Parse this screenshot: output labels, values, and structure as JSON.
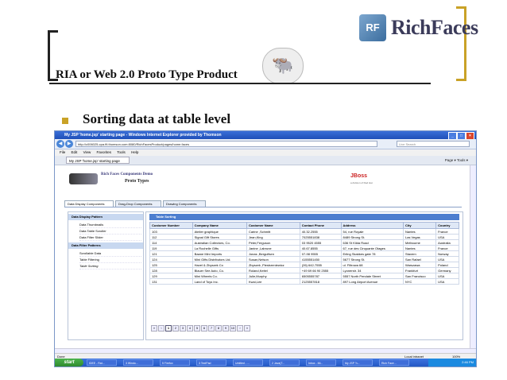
{
  "slide": {
    "logo_text": "RichFaces",
    "title": "RIA or Web 2.0 Proto Type Product",
    "bullet": "Sorting data at table level"
  },
  "browser": {
    "window_title": "My JSP 'home.jsp' starting page - Windows Internet Explorer provided by Thomson",
    "url": "http://c006025-cpa.ftl.thomson.com:8080/RichFacesProduct/pages/home.faces",
    "search_placeholder": "Live Search",
    "menu": [
      "File",
      "Edit",
      "View",
      "Favorites",
      "Tools",
      "Help"
    ],
    "tab_label": "My JSP 'home.jsp' starting page",
    "tab_tools": "Page ▾  Tools ▾",
    "status_left": "Done",
    "status_zone": "Local intranet",
    "status_zoom": "100%"
  },
  "page": {
    "demo_title": "Rich Faces Components Demo",
    "demo_subtitle": "Proto Types",
    "jboss_logo": "JBoss",
    "jboss_sub": "a division of Red Hat",
    "tabs": [
      "Data Display Components",
      "Drag-Drop Components",
      "Drawing Components"
    ],
    "left_panel": {
      "group1_title": "Data Display Pattern",
      "group1_items": [
        "Data Thumbnails",
        "Data Table Scroller",
        "Data Filter Slider"
      ],
      "group2_title": "Data Filter Patterns",
      "group2_items": [
        "Scrollable Data",
        "Table Filtering",
        "Table Sorting"
      ]
    },
    "table": {
      "header": "Table Sorting",
      "columns": [
        "Customer Number",
        "Company Name",
        "Customer Name",
        "Contact Phone",
        "Address",
        "City",
        "Country"
      ],
      "rows": [
        [
          "103",
          "Atelier graphique",
          "Carine ,Schmitt",
          "40.32.2555",
          "54, rue Royale",
          "Nantes",
          "France"
        ],
        [
          "112",
          "Signal Gift Stores",
          "Jean,King",
          "7025551838",
          "8489 Strong St.",
          "Las Vegas",
          "USA"
        ],
        [
          "114",
          "Australian Collectors, Co.",
          "Peter,Ferguson",
          "03 9520 4555",
          "636 St Kilda Road",
          "Melbourne",
          "Australia"
        ],
        [
          "119",
          "La Rochelle Gifts",
          "Janine ,Labrune",
          "40.67.8555",
          "67, rue des Cinquante Otages",
          "Nantes",
          "France"
        ],
        [
          "121",
          "Baane Mini Imports",
          "Jonas ,Bergulfsen",
          "07-98 9555",
          "Erling Skakkes gate 78",
          "Stavern",
          "Norway"
        ],
        [
          "124",
          "Mini Gifts Distributors Ltd.",
          "Susan,Nelson",
          "4155551450",
          "5677 Strong St.",
          "San Rafael",
          "USA"
        ],
        [
          "125",
          "Havel & Zbyszek Co",
          "Zbyszek ,Piestrzeniewicz",
          "(26) 642-7555",
          "ul. Filtrowa 68",
          "Warszawa",
          "Poland"
        ],
        [
          "128",
          "Blauer See Auto, Co.",
          "Roland,Keitel",
          "+49 69 66 90 2555",
          "Lyonerstr. 34",
          "Frankfurt",
          "Germany"
        ],
        [
          "129",
          "Mini Wheels Co.",
          "Julie,Murphy",
          "6505555787",
          "5557 North Pendale Street",
          "San Francisco",
          "USA"
        ],
        [
          "131",
          "Land of Toys Inc.",
          "Kwai,Lee",
          "2125557818",
          "897 Long Airport Avenue",
          "NYC",
          "USA"
        ]
      ],
      "pager": [
        "«",
        "‹",
        "1",
        "2",
        "3",
        "4",
        "5",
        "6",
        "7",
        "8",
        "9",
        "10",
        "›",
        "»"
      ]
    }
  },
  "taskbar": {
    "start": "start",
    "tasks": [
      "IDEE - Rat...",
      "3 Windo...",
      "5 Firefox",
      "3 TextPad",
      "Untitled - ...",
      "2 Java(T...",
      "Inbox - Mi...",
      "My JSP 'h...",
      "Rich Face..."
    ],
    "clock": "2:46 PM"
  }
}
